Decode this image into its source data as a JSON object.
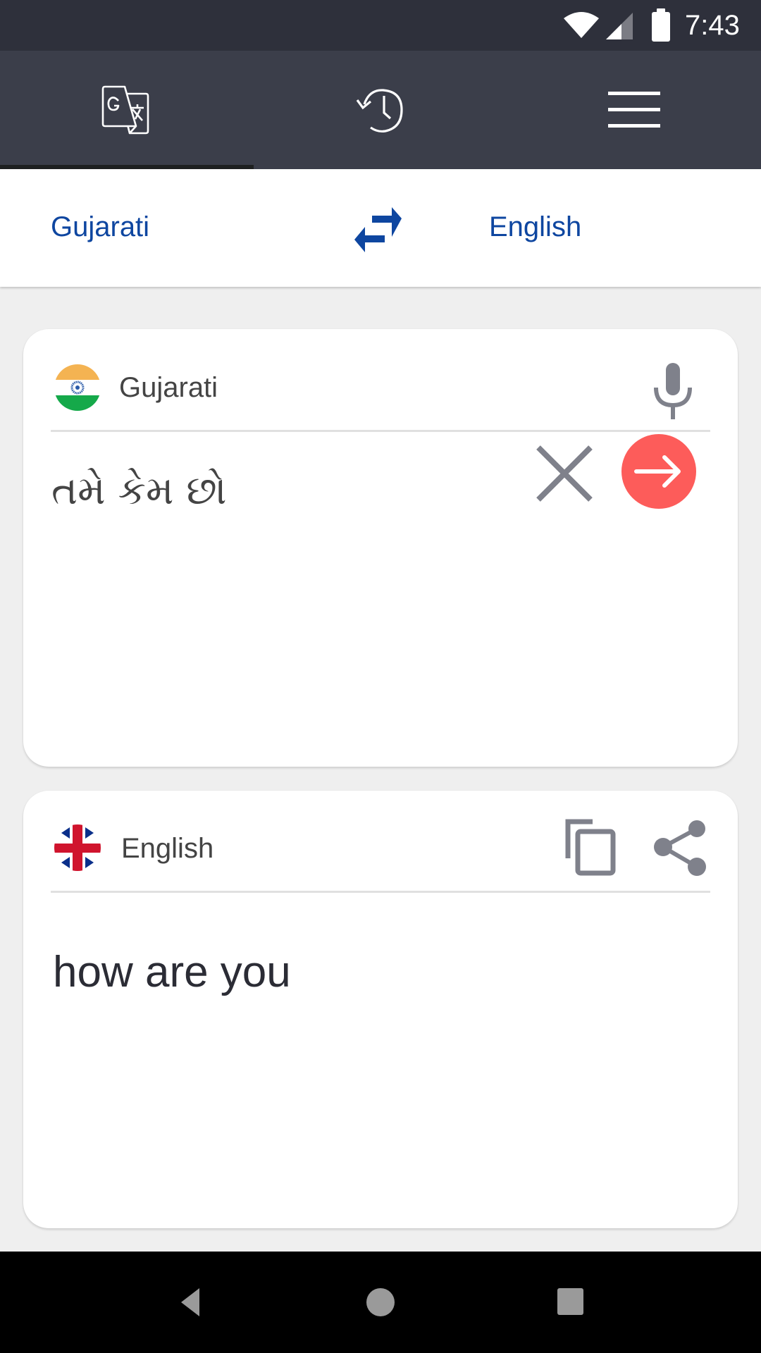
{
  "status_bar": {
    "time": "7:43",
    "icons": [
      "wifi-icon",
      "cellular-signal-icon",
      "battery-icon"
    ]
  },
  "top_tabs": {
    "items": [
      {
        "name": "translate",
        "icon": "translate-icon",
        "selected": true
      },
      {
        "name": "history",
        "icon": "history-icon",
        "selected": false
      },
      {
        "name": "menu",
        "icon": "hamburger-menu-icon",
        "selected": false
      }
    ]
  },
  "language_bar": {
    "source_language": "Gujarati",
    "target_language": "English",
    "swap_icon": "swap-arrows-icon"
  },
  "source_card": {
    "language_label": "Gujarati",
    "flag": "india-flag-icon",
    "input_text": "તમે કેમ છો",
    "mic_icon": "microphone-icon",
    "clear_icon": "close-icon",
    "translate_icon": "arrow-right-icon"
  },
  "target_card": {
    "language_label": "English",
    "flag": "uk-flag-icon",
    "output_text": "how are you",
    "copy_icon": "copy-icon",
    "share_icon": "share-icon"
  },
  "navigation_bar": {
    "buttons": [
      "back",
      "home",
      "recents"
    ]
  },
  "colors": {
    "status_bar_bg": "#2e303b",
    "header_bg": "#3b3e4a",
    "tab_indicator": "#1e2021",
    "accent_blue": "#0e46a0",
    "translate_button": "#fd5c5a",
    "icon_gray": "#7f818b",
    "page_bg": "#efefef"
  }
}
